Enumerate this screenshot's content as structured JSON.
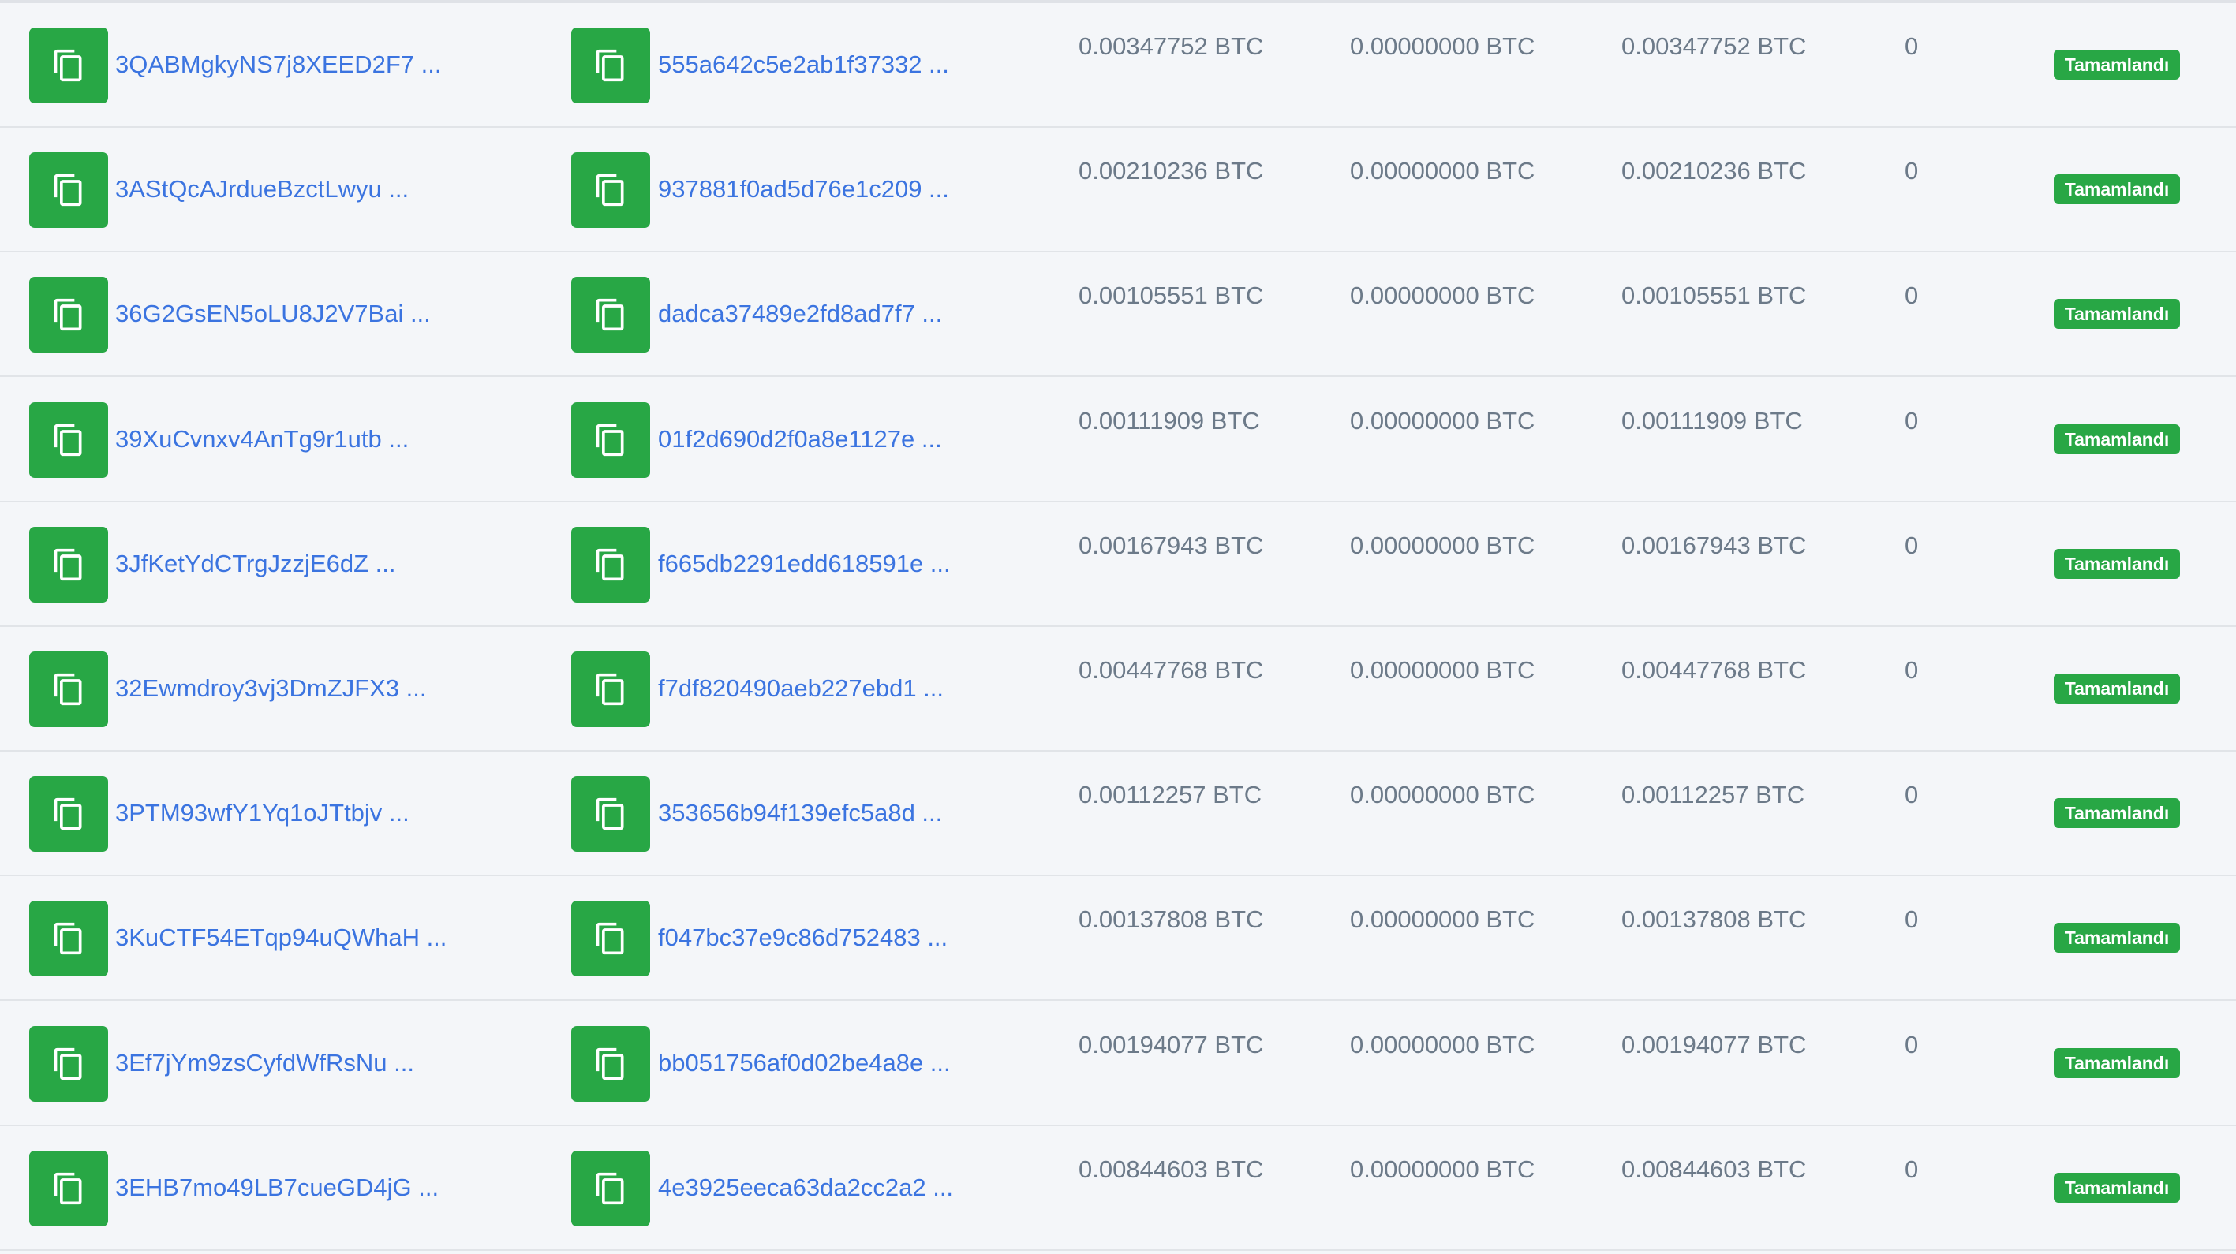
{
  "colors": {
    "accent": "#28a745",
    "link": "#3b74e0",
    "muted_text": "#6c7a89",
    "background": "#f4f6f9"
  },
  "icons": {
    "copy": "copy-icon"
  },
  "rows": [
    {
      "address": "3QABMgkyNS7j8XEED2F7 ...",
      "tx_hash": "555a642c5e2ab1f37332 ...",
      "amount": "0.00347752 BTC",
      "fee": "0.00000000 BTC",
      "total": "0.00347752 BTC",
      "confirmations": "0",
      "status": "Tamamlandı"
    },
    {
      "address": "3AStQcAJrdueBzctLwyu ...",
      "tx_hash": "937881f0ad5d76e1c209 ...",
      "amount": "0.00210236 BTC",
      "fee": "0.00000000 BTC",
      "total": "0.00210236 BTC",
      "confirmations": "0",
      "status": "Tamamlandı"
    },
    {
      "address": "36G2GsEN5oLU8J2V7Bai ...",
      "tx_hash": "dadca37489e2fd8ad7f7 ...",
      "amount": "0.00105551 BTC",
      "fee": "0.00000000 BTC",
      "total": "0.00105551 BTC",
      "confirmations": "0",
      "status": "Tamamlandı"
    },
    {
      "address": "39XuCvnxv4AnTg9r1utb ...",
      "tx_hash": "01f2d690d2f0a8e1127e ...",
      "amount": "0.00111909 BTC",
      "fee": "0.00000000 BTC",
      "total": "0.00111909 BTC",
      "confirmations": "0",
      "status": "Tamamlandı"
    },
    {
      "address": "3JfKetYdCTrgJzzjE6dZ ...",
      "tx_hash": "f665db2291edd618591e ...",
      "amount": "0.00167943 BTC",
      "fee": "0.00000000 BTC",
      "total": "0.00167943 BTC",
      "confirmations": "0",
      "status": "Tamamlandı"
    },
    {
      "address": "32Ewmdroy3vj3DmZJFX3 ...",
      "tx_hash": "f7df820490aeb227ebd1 ...",
      "amount": "0.00447768 BTC",
      "fee": "0.00000000 BTC",
      "total": "0.00447768 BTC",
      "confirmations": "0",
      "status": "Tamamlandı"
    },
    {
      "address": "3PTM93wfY1Yq1oJTtbjv ...",
      "tx_hash": "353656b94f139efc5a8d ...",
      "amount": "0.00112257 BTC",
      "fee": "0.00000000 BTC",
      "total": "0.00112257 BTC",
      "confirmations": "0",
      "status": "Tamamlandı"
    },
    {
      "address": "3KuCTF54ETqp94uQWhaH ...",
      "tx_hash": "f047bc37e9c86d752483 ...",
      "amount": "0.00137808 BTC",
      "fee": "0.00000000 BTC",
      "total": "0.00137808 BTC",
      "confirmations": "0",
      "status": "Tamamlandı"
    },
    {
      "address": "3Ef7jYm9zsCyfdWfRsNu ...",
      "tx_hash": "bb051756af0d02be4a8e ...",
      "amount": "0.00194077 BTC",
      "fee": "0.00000000 BTC",
      "total": "0.00194077 BTC",
      "confirmations": "0",
      "status": "Tamamlandı"
    },
    {
      "address": "3EHB7mo49LB7cueGD4jG ...",
      "tx_hash": "4e3925eeca63da2cc2a2 ...",
      "amount": "0.00844603 BTC",
      "fee": "0.00000000 BTC",
      "total": "0.00844603 BTC",
      "confirmations": "0",
      "status": "Tamamlandı"
    }
  ]
}
